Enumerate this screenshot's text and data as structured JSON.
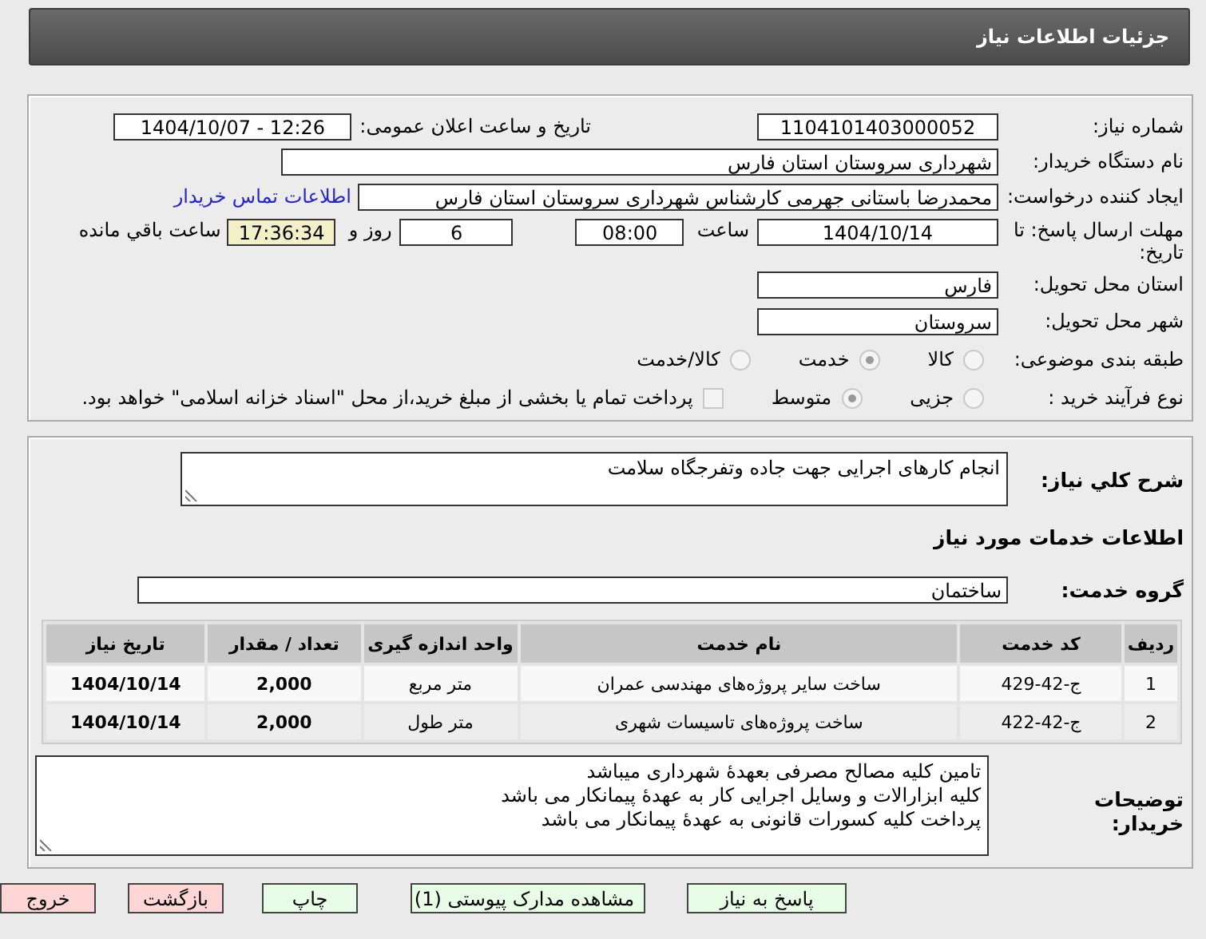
{
  "header": {
    "title": "جزئیات اطلاعات نیاز"
  },
  "need_number": {
    "label": "شماره نیاز:",
    "value": "1104101403000052"
  },
  "announce": {
    "label": "تاریخ و ساعت اعلان عمومی:",
    "value": "1404/10/07 - 12:26"
  },
  "buyer": {
    "label": "نام دستگاه خریدار:",
    "value": "شهرداری سروستان استان فارس"
  },
  "creator": {
    "label": "ایجاد کننده درخواست:",
    "value": "محمدرضا باستانی جهرمی کارشناس شهرداری سروستان استان فارس",
    "link": "اطلاعات تماس خریدار"
  },
  "deadline": {
    "label": "مهلت ارسال پاسخ: تا تاریخ:",
    "date": "1404/10/14",
    "time_label": "ساعت",
    "time": "08:00",
    "days": "6",
    "days_label": "روز و",
    "remaining": "17:36:34",
    "remaining_label": "ساعت باقي مانده"
  },
  "province": {
    "label": "استان محل تحویل:",
    "value": "فارس"
  },
  "city": {
    "label": "شهر محل تحویل:",
    "value": "سروستان"
  },
  "category": {
    "label": "طبقه بندی موضوعی:",
    "options": [
      {
        "label": "کالا",
        "selected": false
      },
      {
        "label": "خدمت",
        "selected": true
      },
      {
        "label": "کالا/خدمت",
        "selected": false
      }
    ]
  },
  "process": {
    "label": "نوع فرآیند خرید :",
    "options": [
      {
        "label": "جزیی",
        "selected": false
      },
      {
        "label": "متوسط",
        "selected": true
      }
    ],
    "payment": {
      "checked": false,
      "text": "پرداخت تمام یا بخشی از مبلغ خرید،از محل \"اسناد خزانه اسلامی\" خواهد بود."
    }
  },
  "summary": {
    "label": "شرح کلي نياز:",
    "value": "انجام کارهای اجرایی جهت جاده وتفرجگاه سلامت"
  },
  "services_title": "اطلاعات خدمات مورد نیاز",
  "service_group": {
    "label": "گروه خدمت:",
    "value": "ساختمان"
  },
  "table": {
    "columns": [
      "ردیف",
      "کد خدمت",
      "نام خدمت",
      "واحد اندازه گیری",
      "تعداد / مقدار",
      "تاریخ نیاز"
    ],
    "rows": [
      [
        "1",
        "ج-42-429",
        "ساخت سایر پروژه‌های مهندسی عمران",
        "متر مربع",
        "2,000",
        "1404/10/14"
      ],
      [
        "2",
        "ج-42-422",
        "ساخت پروژه‌های تاسیسات شهری",
        "متر طول",
        "2,000",
        "1404/10/14"
      ]
    ]
  },
  "notes": {
    "label": "توضیحات خریدار:",
    "lines": [
      "تامین کلیه مصالح مصرفی بعهدۀ شهرداری میباشد",
      "کلیه ابزارالات و وسایل اجرایی کار به عهدۀ پیمانکار می باشد",
      "پرداخت کلیه کسورات قانونی به عهدۀ پیمانکار می باشد"
    ]
  },
  "buttons": [
    {
      "label": "پاسخ به نیاز",
      "kind": "normal"
    },
    {
      "label": "مشاهده مدارک پیوستی (1)",
      "kind": "normal"
    },
    {
      "label": "چاپ",
      "kind": "normal"
    },
    {
      "label": "بازگشت",
      "kind": "danger"
    },
    {
      "label": "خروج",
      "kind": "danger"
    }
  ]
}
